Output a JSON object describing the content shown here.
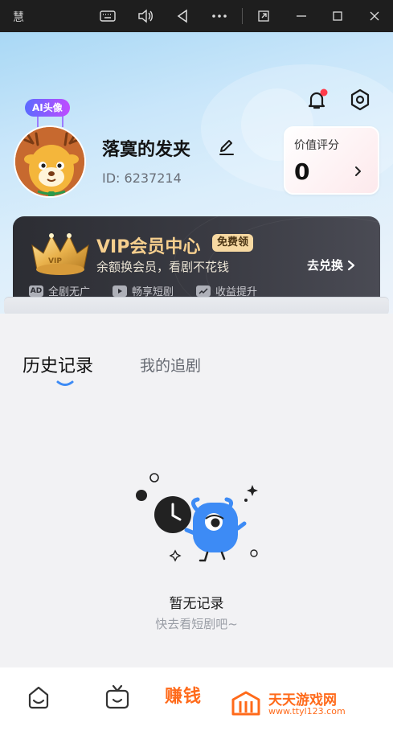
{
  "window": {
    "title": "慧",
    "controls": [
      "keyboard-icon",
      "volume-icon",
      "back-triangle-icon",
      "more-icon",
      "popout-icon",
      "minimize-icon",
      "maximize-icon",
      "close-icon"
    ]
  },
  "profile": {
    "ai_badge": "AI头像",
    "nickname": "落寞的发夹",
    "id_text": "ID: 6237214",
    "score_label": "价值评分",
    "score_value": "0"
  },
  "vip": {
    "title": "VIP会员中心",
    "free_tag": "免费领",
    "subtitle": "余额换会员，看剧不花钱",
    "action": "去兑换",
    "features": [
      {
        "icon": "AD",
        "label": "全剧无广"
      },
      {
        "icon": "play",
        "label": "畅享短剧"
      },
      {
        "icon": "trend",
        "label": "收益提升"
      }
    ]
  },
  "tabs": {
    "active": "历史记录",
    "other": "我的追剧"
  },
  "empty": {
    "title": "暂无记录",
    "subtitle": "快去看短剧吧~"
  },
  "bottom_nav": {
    "earn_label": "赚钱"
  },
  "watermark": {
    "title": "天天游戏网",
    "url": "www.ttyl123.com"
  },
  "colors": {
    "vip_gold": "#f6cf8e",
    "accent_blue": "#3d8bf5",
    "badge_red": "#ff3b4a",
    "watermark_orange": "#ff6a1a"
  }
}
